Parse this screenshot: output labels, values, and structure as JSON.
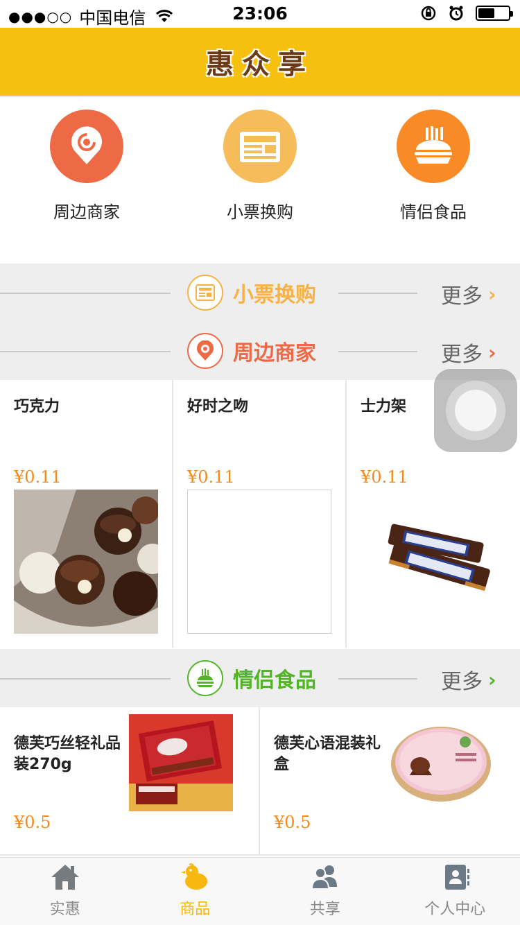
{
  "status_bar": {
    "signal": "●●●○○",
    "carrier": "中国电信",
    "time": "23:06",
    "battery_level": 0.55
  },
  "header": {
    "title": "惠众享"
  },
  "quick_nav": [
    {
      "label": "周边商家",
      "icon": "location-pin-icon",
      "color": "#ee6a47"
    },
    {
      "label": "小票换购",
      "icon": "receipt-icon",
      "color": "#f7bc5a"
    },
    {
      "label": "情侣食品",
      "icon": "burger-fries-icon",
      "color": "#f98a26"
    }
  ],
  "sections": {
    "receipt": {
      "title": "小票换购",
      "more": "更多",
      "color": "#f7b247"
    },
    "nearby": {
      "title": "周边商家",
      "more": "更多",
      "color": "#ee6a47"
    },
    "couple": {
      "title": "情侣食品",
      "more": "更多",
      "color": "#52b526"
    }
  },
  "nearby_products": [
    {
      "name": "巧克力",
      "price": "¥0.11",
      "image": "chocolate-image"
    },
    {
      "name": "好时之吻",
      "price": "¥0.11",
      "image": "blank-image"
    },
    {
      "name": "士力架",
      "price": "¥0.11",
      "image": "snickers-image"
    }
  ],
  "couple_products": [
    {
      "name": "德芙巧丝轻礼品装270g",
      "price": "¥0.5",
      "image": "dove-gift-box-image"
    },
    {
      "name": "德芙心语混装礼盒",
      "price": "¥0.5",
      "image": "dove-round-box-image"
    }
  ],
  "tabs": [
    {
      "label": "实惠",
      "icon": "home-icon",
      "active": false
    },
    {
      "label": "商品",
      "icon": "chick-icon",
      "active": true
    },
    {
      "label": "共享",
      "icon": "people-icon",
      "active": false
    },
    {
      "label": "个人中心",
      "icon": "contacts-icon",
      "active": false
    }
  ],
  "colors": {
    "accent": "#f6c011",
    "price": "#f08a1c",
    "tab_active": "#f6b70f",
    "tab_inactive": "#8a8a8a"
  }
}
